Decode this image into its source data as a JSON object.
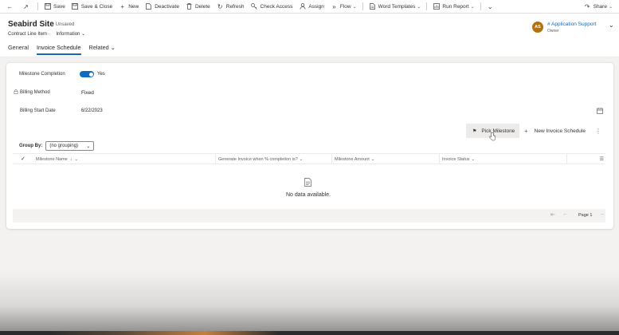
{
  "command_bar": {
    "save": "Save",
    "save_close": "Save & Close",
    "new": "New",
    "deactivate": "Deactivate",
    "delete": "Delete",
    "refresh": "Refresh",
    "check_access": "Check Access",
    "assign": "Assign",
    "flow": "Flow",
    "word_templates": "Word Templates",
    "run_report": "Run Report",
    "share": "Share"
  },
  "header": {
    "title": "Seabird Site",
    "status": "- Unsaved",
    "entity": "Contract Line Item",
    "form": "Information",
    "tabs": [
      "General",
      "Invoice Schedule",
      "Related"
    ],
    "active_tab": "Invoice Schedule",
    "owner": {
      "initials": "AS",
      "name": "# Application Support",
      "role": "Owner",
      "avatar_color": "#b5730e"
    }
  },
  "form": {
    "milestone_completion_label": "Milestone Completion",
    "milestone_completion_value": "Yes",
    "billing_method_label": "Billing Method",
    "billing_method_value": "Fixed",
    "billing_start_date_label": "Billing Start Date",
    "billing_start_date_value": "6/22/2023"
  },
  "subgrid": {
    "pick_milestone": "Pick Milestone",
    "new_invoice_schedule": "New Invoice Schedule",
    "group_by_label": "Group By:",
    "group_by_value": "(no grouping)",
    "columns": [
      "Milestone Name",
      "Generate Invoice when % completion is?",
      "Milestone Amount",
      "Invoice Status"
    ],
    "empty_message": "No data available.",
    "page_label": "Page 1"
  },
  "colors": {
    "accent": "#0f6cbd",
    "background": "#f3f2f1"
  }
}
